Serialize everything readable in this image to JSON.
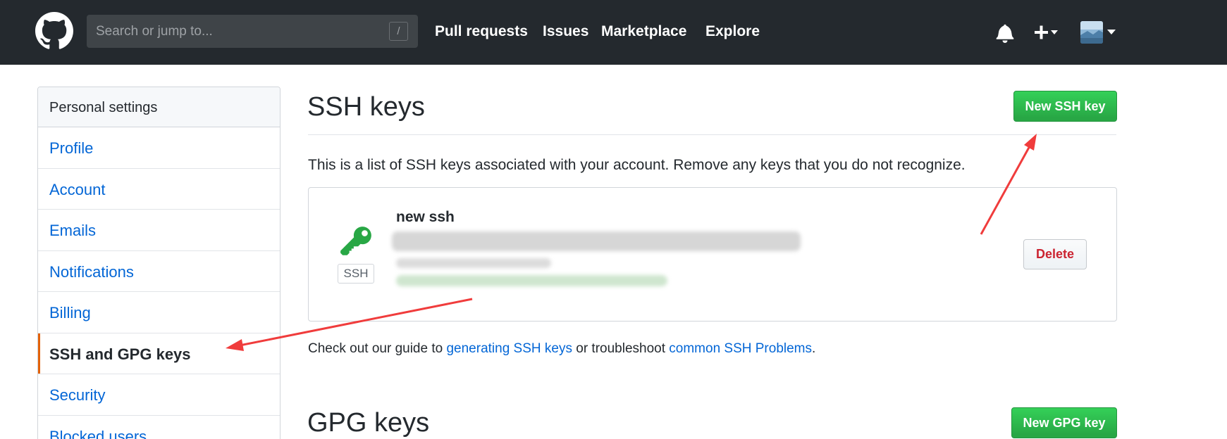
{
  "header": {
    "search_placeholder": "Search or jump to...",
    "search_shortcut": "/",
    "nav": [
      "Pull requests",
      "Issues",
      "Marketplace",
      "Explore"
    ],
    "icons": [
      "github-logo",
      "bell-icon",
      "plus-icon",
      "avatar"
    ]
  },
  "sidebar": {
    "heading": "Personal settings",
    "items": [
      {
        "label": "Profile"
      },
      {
        "label": "Account"
      },
      {
        "label": "Emails"
      },
      {
        "label": "Notifications"
      },
      {
        "label": "Billing"
      },
      {
        "label": "SSH and GPG keys",
        "selected": true
      },
      {
        "label": "Security"
      },
      {
        "label": "Blocked users"
      }
    ]
  },
  "ssh": {
    "title": "SSH keys",
    "new_button": "New SSH key",
    "description": "This is a list of SSH keys associated with your account. Remove any keys that you do not recognize.",
    "key": {
      "name": "new ssh",
      "type_badge": "SSH",
      "delete_button": "Delete"
    },
    "guide": {
      "pre": "Check out our guide to ",
      "link1": "generating SSH keys",
      "mid": " or troubleshoot ",
      "link2": "common SSH Problems",
      "post": "."
    }
  },
  "gpg": {
    "title": "GPG keys",
    "new_button": "New GPG key"
  },
  "colors": {
    "header_bg": "#24292e",
    "link": "#0366d6",
    "green": "#28a745",
    "danger": "#cb2431",
    "selected_marker": "#e36209",
    "annotation_arrow": "#f03c3c"
  }
}
